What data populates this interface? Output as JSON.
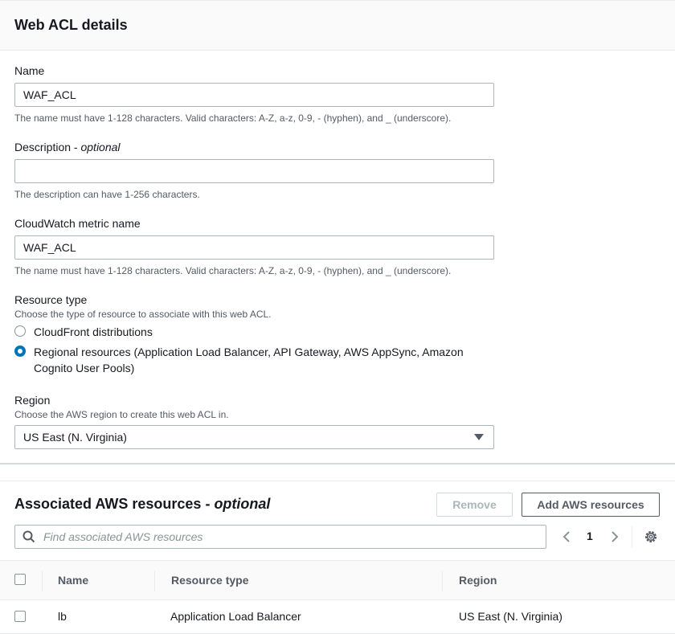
{
  "details": {
    "title": "Web ACL details",
    "name": {
      "label": "Name",
      "value": "WAF_ACL",
      "hint": "The name must have 1-128 characters. Valid characters: A-Z, a-z, 0-9, - (hyphen), and _ (underscore)."
    },
    "description": {
      "label": "Description",
      "optional": "optional",
      "separator": " - ",
      "value": "",
      "hint": "The description can have 1-256 characters."
    },
    "metric": {
      "label": "CloudWatch metric name",
      "value": "WAF_ACL",
      "hint": "The name must have 1-128 characters. Valid characters: A-Z, a-z, 0-9, - (hyphen), and _ (underscore)."
    },
    "resource_type": {
      "label": "Resource type",
      "sublabel": "Choose the type of resource to associate with this web ACL.",
      "options": [
        {
          "label": "CloudFront distributions",
          "checked": false
        },
        {
          "label": "Regional resources (Application Load Balancer, API Gateway, AWS AppSync, Amazon Cognito User Pools)",
          "checked": true
        }
      ]
    },
    "region": {
      "label": "Region",
      "sublabel": "Choose the AWS region to create this web ACL in.",
      "selected": "US East (N. Virginia)"
    }
  },
  "resources": {
    "title": "Associated AWS resources",
    "title_separator": " - ",
    "title_optional": "optional",
    "remove_label": "Remove",
    "add_label": "Add AWS resources",
    "search_placeholder": "Find associated AWS resources",
    "page": "1",
    "columns": [
      "Name",
      "Resource type",
      "Region"
    ],
    "rows": [
      {
        "name": "lb",
        "type": "Application Load Balancer",
        "region": "US East (N. Virginia)"
      }
    ]
  },
  "colors": {
    "accent": "#0073bb",
    "text": "#16191f",
    "muted": "#545b64"
  },
  "icons": [
    "search-icon",
    "chevron-left-icon",
    "chevron-right-icon",
    "gear-icon",
    "caret-down-icon"
  ]
}
